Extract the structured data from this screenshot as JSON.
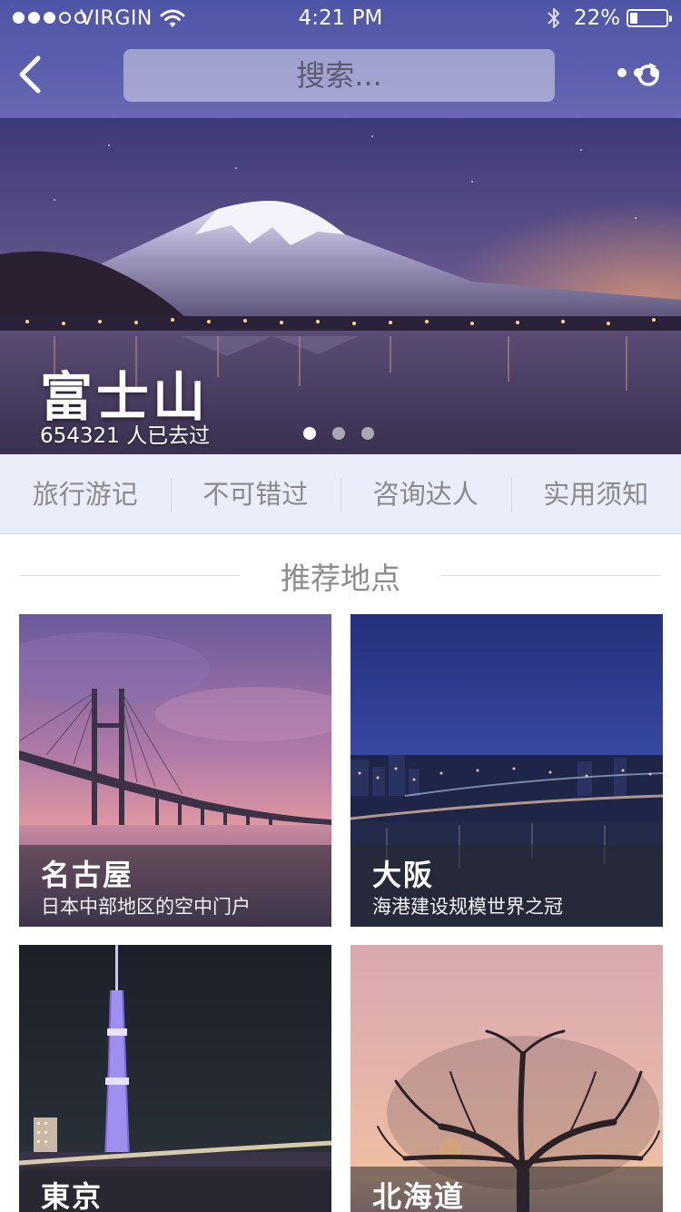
{
  "status_bar": {
    "carrier": "VIRGIN",
    "time": "4:21 PM",
    "battery_percent_label": "22%",
    "battery_level": 0.22,
    "signal_strength": 3,
    "signal_max": 5,
    "icons": [
      "wifi-icon",
      "bluetooth-icon",
      "battery-icon"
    ]
  },
  "nav": {
    "back_icon": "back-chevron-icon",
    "search_placeholder": "搜索...",
    "refresh_icon": "refresh-icon",
    "more_icon": "more-dots-icon"
  },
  "hero": {
    "title": "富士山",
    "subtitle": "654321 人已去过",
    "slide_count": 3,
    "active_slide": 1
  },
  "tabs": [
    {
      "label": "旅行游记"
    },
    {
      "label": "不可错过"
    },
    {
      "label": "咨询达人"
    },
    {
      "label": "实用须知"
    }
  ],
  "section": {
    "title": "推荐地点"
  },
  "places": [
    {
      "name": "名古屋",
      "description": "日本中部地区的空中门户",
      "image": "bridge-sunset"
    },
    {
      "name": "大阪",
      "description": "海港建设规模世界之冠",
      "image": "city-night"
    },
    {
      "name": "東京",
      "description": "",
      "image": "tower-night"
    },
    {
      "name": "北海道",
      "description": "",
      "image": "tree-sunset"
    }
  ],
  "colors": {
    "nav_background": "#5c5fae",
    "tab_background": "#eaeefa",
    "tab_text": "#8a8a8a",
    "section_title": "#8c8c8c"
  }
}
